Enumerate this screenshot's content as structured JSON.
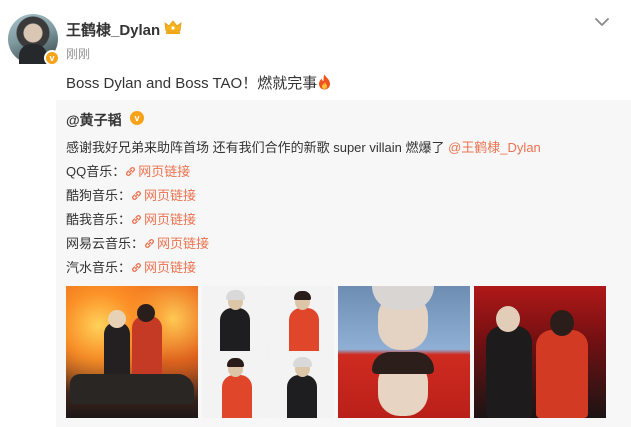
{
  "post": {
    "author": "王鹤棣_Dylan",
    "time": "刚刚",
    "text": "Boss Dylan and Boss TAO！燃就完事"
  },
  "repost": {
    "author": "@黄子韬",
    "line1_text": "感谢我好兄弟来助阵首场 还有我们合作的新歌 super villain 燃爆了",
    "line1_mention": "@王鹤棣_Dylan",
    "links": [
      {
        "label": "QQ音乐：",
        "link_text": "网页链接"
      },
      {
        "label": "酷狗音乐：",
        "link_text": "网页链接"
      },
      {
        "label": "酷我音乐：",
        "link_text": "网页链接"
      },
      {
        "label": "网易云音乐：",
        "link_text": "网页链接"
      },
      {
        "label": "汽水音乐：",
        "link_text": "网页链接"
      }
    ]
  },
  "colors": {
    "accent": "#eb7350",
    "verified": "#f7a21b",
    "muted": "#939393"
  },
  "icons": [
    "verified-badge-icon",
    "vip-crown-icon",
    "chevron-down-icon",
    "fire-emoji-icon",
    "link-icon"
  ]
}
